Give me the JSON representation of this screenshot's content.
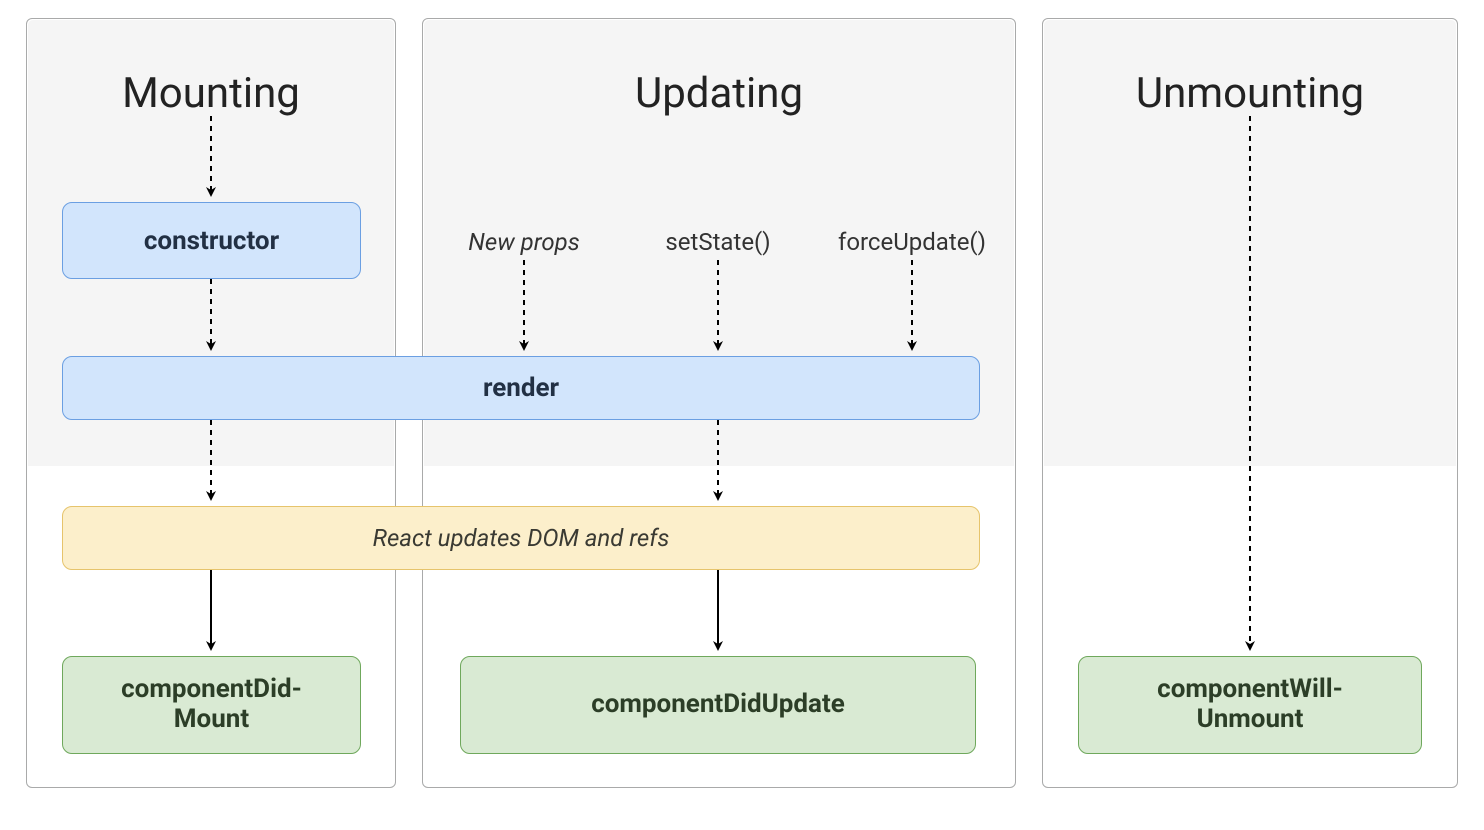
{
  "columns": {
    "mounting": {
      "title": "Mounting"
    },
    "updating": {
      "title": "Updating"
    },
    "unmounting": {
      "title": "Unmounting"
    }
  },
  "triggers": {
    "new_props": "New props",
    "set_state": "setState()",
    "force_update": "forceUpdate()"
  },
  "nodes": {
    "constructor": "constructor",
    "render": "render",
    "react_updates": "React updates DOM and refs",
    "did_mount": "componentDid- Mount",
    "did_update": "componentDidUpdate",
    "will_unmount": "componentWill- Unmount"
  },
  "colors": {
    "blue_fill": "#d2e5fc",
    "yellow_fill": "#fcefcb",
    "green_fill": "#d9ead3"
  }
}
